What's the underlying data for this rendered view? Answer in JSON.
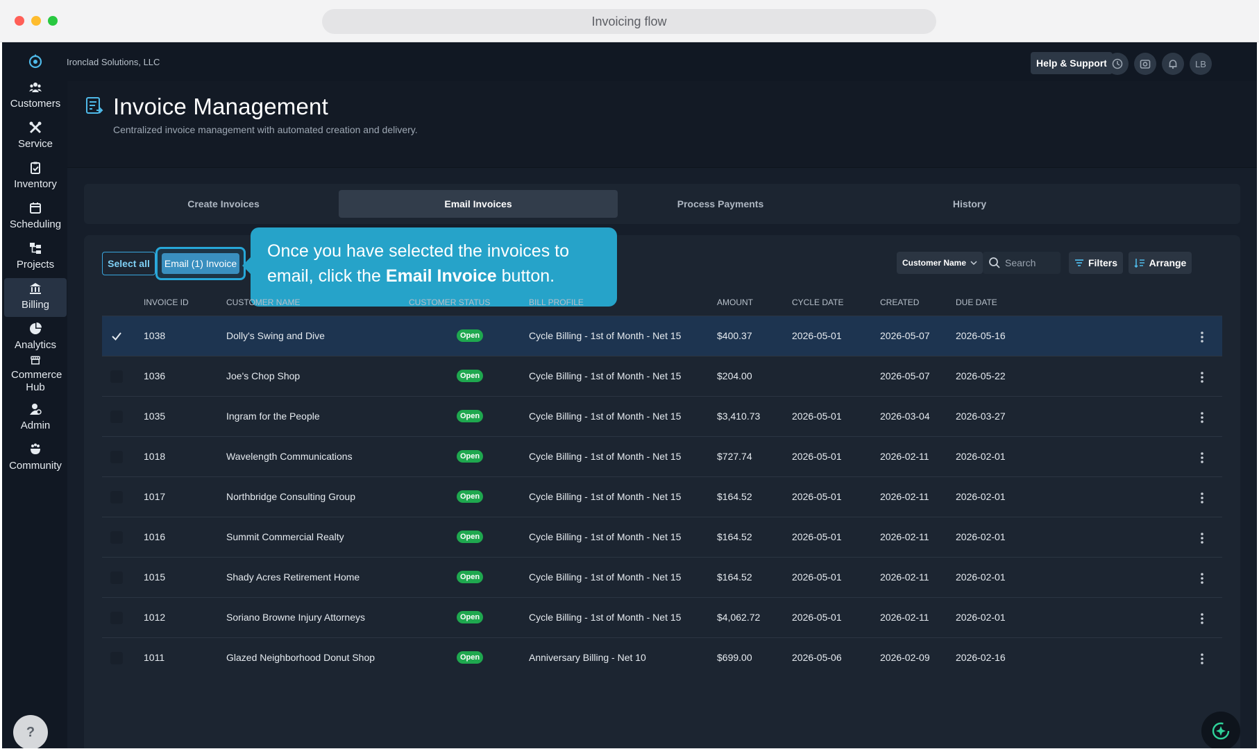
{
  "browser": {
    "url_title": "Invoicing flow"
  },
  "topbar": {
    "company": "Ironclad Solutions, LLC",
    "help_label": "Help & Support",
    "avatar_initials": "LB"
  },
  "sidebar": {
    "items": [
      {
        "label": "Customers",
        "icon": "users-icon"
      },
      {
        "label": "Service",
        "icon": "tools-icon"
      },
      {
        "label": "Inventory",
        "icon": "clipboard-icon"
      },
      {
        "label": "Scheduling",
        "icon": "calendar-icon"
      },
      {
        "label": "Projects",
        "icon": "hierarchy-icon"
      },
      {
        "label": "Billing",
        "icon": "bank-icon"
      },
      {
        "label": "Analytics",
        "icon": "pie-chart-icon"
      },
      {
        "label": "Commerce Hub",
        "icon": "store-icon"
      },
      {
        "label": "Admin",
        "icon": "admin-icon"
      },
      {
        "label": "Community",
        "icon": "community-icon"
      }
    ],
    "active": "Billing",
    "help_glyph": "?"
  },
  "page": {
    "title": "Invoice Management",
    "subtitle": "Centralized invoice management with automated creation and delivery."
  },
  "tabs": [
    {
      "label": "Create Invoices"
    },
    {
      "label": "Email Invoices"
    },
    {
      "label": "Process Payments"
    },
    {
      "label": "History"
    }
  ],
  "active_tab": "Email Invoices",
  "actions": {
    "select_all": "Select all",
    "email_invoice": "Email (1) Invoice"
  },
  "tooltip": {
    "text_before": "Once you have selected the invoices to email, click the ",
    "bold": "Email Invoice",
    "text_after": " button."
  },
  "toolbar": {
    "customer_select": "Customer Name",
    "search_placeholder": "Search",
    "filters": "Filters",
    "arrange": "Arrange"
  },
  "table": {
    "headers": [
      "INVOICE ID",
      "CUSTOMER NAME",
      "CUSTOMER STATUS",
      "BILL PROFILE",
      "AMOUNT",
      "CYCLE DATE",
      "CREATED",
      "DUE DATE"
    ],
    "rows": [
      {
        "id": "1038",
        "customer": "Dolly's Swing and Dive",
        "status": "Open",
        "profile": "Cycle Billing - 1st of Month - Net 15",
        "amount": "$400.37",
        "cycle": "2026-05-01",
        "created": "2026-05-07",
        "due": "2026-05-16",
        "selected": true
      },
      {
        "id": "1036",
        "customer": "Joe's Chop Shop",
        "status": "Open",
        "profile": "Cycle Billing - 1st of Month - Net 15",
        "amount": "$204.00",
        "cycle": "",
        "created": "2026-05-07",
        "due": "2026-05-22",
        "selected": false
      },
      {
        "id": "1035",
        "customer": "Ingram for the People",
        "status": "Open",
        "profile": "Cycle Billing - 1st of Month - Net 15",
        "amount": "$3,410.73",
        "cycle": "2026-05-01",
        "created": "2026-03-04",
        "due": "2026-03-27",
        "selected": false
      },
      {
        "id": "1018",
        "customer": "Wavelength Communications",
        "status": "Open",
        "profile": "Cycle Billing - 1st of Month - Net 15",
        "amount": "$727.74",
        "cycle": "2026-05-01",
        "created": "2026-02-11",
        "due": "2026-02-01",
        "selected": false
      },
      {
        "id": "1017",
        "customer": "Northbridge Consulting Group",
        "status": "Open",
        "profile": "Cycle Billing - 1st of Month - Net 15",
        "amount": "$164.52",
        "cycle": "2026-05-01",
        "created": "2026-02-11",
        "due": "2026-02-01",
        "selected": false
      },
      {
        "id": "1016",
        "customer": "Summit Commercial Realty",
        "status": "Open",
        "profile": "Cycle Billing - 1st of Month - Net 15",
        "amount": "$164.52",
        "cycle": "2026-05-01",
        "created": "2026-02-11",
        "due": "2026-02-01",
        "selected": false
      },
      {
        "id": "1015",
        "customer": "Shady Acres Retirement Home",
        "status": "Open",
        "profile": "Cycle Billing - 1st of Month - Net 15",
        "amount": "$164.52",
        "cycle": "2026-05-01",
        "created": "2026-02-11",
        "due": "2026-02-01",
        "selected": false
      },
      {
        "id": "1012",
        "customer": "Soriano Browne Injury Attorneys",
        "status": "Open",
        "profile": "Cycle Billing - 1st of Month - Net 15",
        "amount": "$4,062.72",
        "cycle": "2026-05-01",
        "created": "2026-02-11",
        "due": "2026-02-01",
        "selected": false
      },
      {
        "id": "1011",
        "customer": "Glazed Neighborhood Donut Shop",
        "status": "Open",
        "profile": "Anniversary Billing - Net 10",
        "amount": "$699.00",
        "cycle": "2026-05-06",
        "created": "2026-02-09",
        "due": "2026-02-16",
        "selected": false
      }
    ]
  },
  "colors": {
    "accent": "#27a7d8",
    "status_open": "#1fa84f",
    "selected_row": "#1d3450",
    "background": "#111823"
  }
}
